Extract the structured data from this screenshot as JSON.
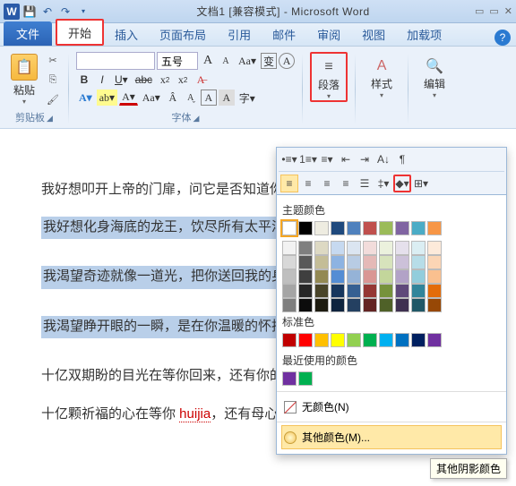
{
  "title": "文档1 [兼容模式] - Microsoft Word",
  "tabs": {
    "file": "文件",
    "home": "开始",
    "insert": "插入",
    "layout": "页面布局",
    "ref": "引用",
    "mail": "邮件",
    "review": "审阅",
    "view": "视图",
    "addin": "加载项"
  },
  "groups": {
    "clipboard": "剪贴板",
    "font": "字体",
    "para": "段落",
    "styles": "样式",
    "editing": "编辑"
  },
  "paste_label": "粘贴",
  "font": {
    "name": "",
    "size": "五号",
    "grow_label": "A",
    "shrink_label": "A"
  },
  "colors": {
    "theme_label": "主题颜色",
    "standard_label": "标准色",
    "recent_label": "最近使用的颜色",
    "none_label": "无颜色(N)",
    "more_label": "其他颜色(M)...",
    "tooltip": "其他阴影颜色",
    "theme_row1": [
      "#ffffff",
      "#000000",
      "#eeece1",
      "#1f497d",
      "#4f81bd",
      "#c0504d",
      "#9bbb59",
      "#8064a2",
      "#4bacc6",
      "#f79646"
    ],
    "theme_shades": [
      [
        "#f2f2f2",
        "#7f7f7f",
        "#ddd9c3",
        "#c6d9f0",
        "#dbe5f1",
        "#f2dcdb",
        "#ebf1dd",
        "#e5e0ec",
        "#dbeef3",
        "#fdeada"
      ],
      [
        "#d8d8d8",
        "#595959",
        "#c4bd97",
        "#8db3e2",
        "#b8cce4",
        "#e5b9b7",
        "#d7e3bc",
        "#ccc1d9",
        "#b7dde8",
        "#fbd5b5"
      ],
      [
        "#bfbfbf",
        "#3f3f3f",
        "#938953",
        "#548dd4",
        "#95b3d7",
        "#d99694",
        "#c3d69b",
        "#b2a2c7",
        "#92cddc",
        "#fac08f"
      ],
      [
        "#a5a5a5",
        "#262626",
        "#494429",
        "#17365d",
        "#366092",
        "#953734",
        "#76923c",
        "#5f497a",
        "#31859b",
        "#e36c09"
      ],
      [
        "#7f7f7f",
        "#0c0c0c",
        "#1d1b10",
        "#0f243e",
        "#244061",
        "#632423",
        "#4f6128",
        "#3f3151",
        "#205867",
        "#974806"
      ]
    ],
    "standard": [
      "#c00000",
      "#ff0000",
      "#ffc000",
      "#ffff00",
      "#92d050",
      "#00b050",
      "#00b0f0",
      "#0070c0",
      "#002060",
      "#7030a0"
    ],
    "recent": [
      "#7030a0",
      "#00b050"
    ]
  },
  "document": {
    "p1": "我好想叩开上帝的门扉，问它是否知道你们去了何方",
    "p2": "我好想化身海底的龙王，饮尽所有太平洋的水域",
    "p3": "我渴望奇迹就像一道光，把你送回我的身旁",
    "p4": "我渴望睁开眼的一瞬，是在你温暖的怀抱中睡醒",
    "p5": "十亿双期盼的目光在等你回来，还有你的儿女",
    "p6_a": "十亿颗祈福的心在等你 ",
    "p6_b": "huijia",
    "p6_c": "，还有母心的召唤"
  }
}
